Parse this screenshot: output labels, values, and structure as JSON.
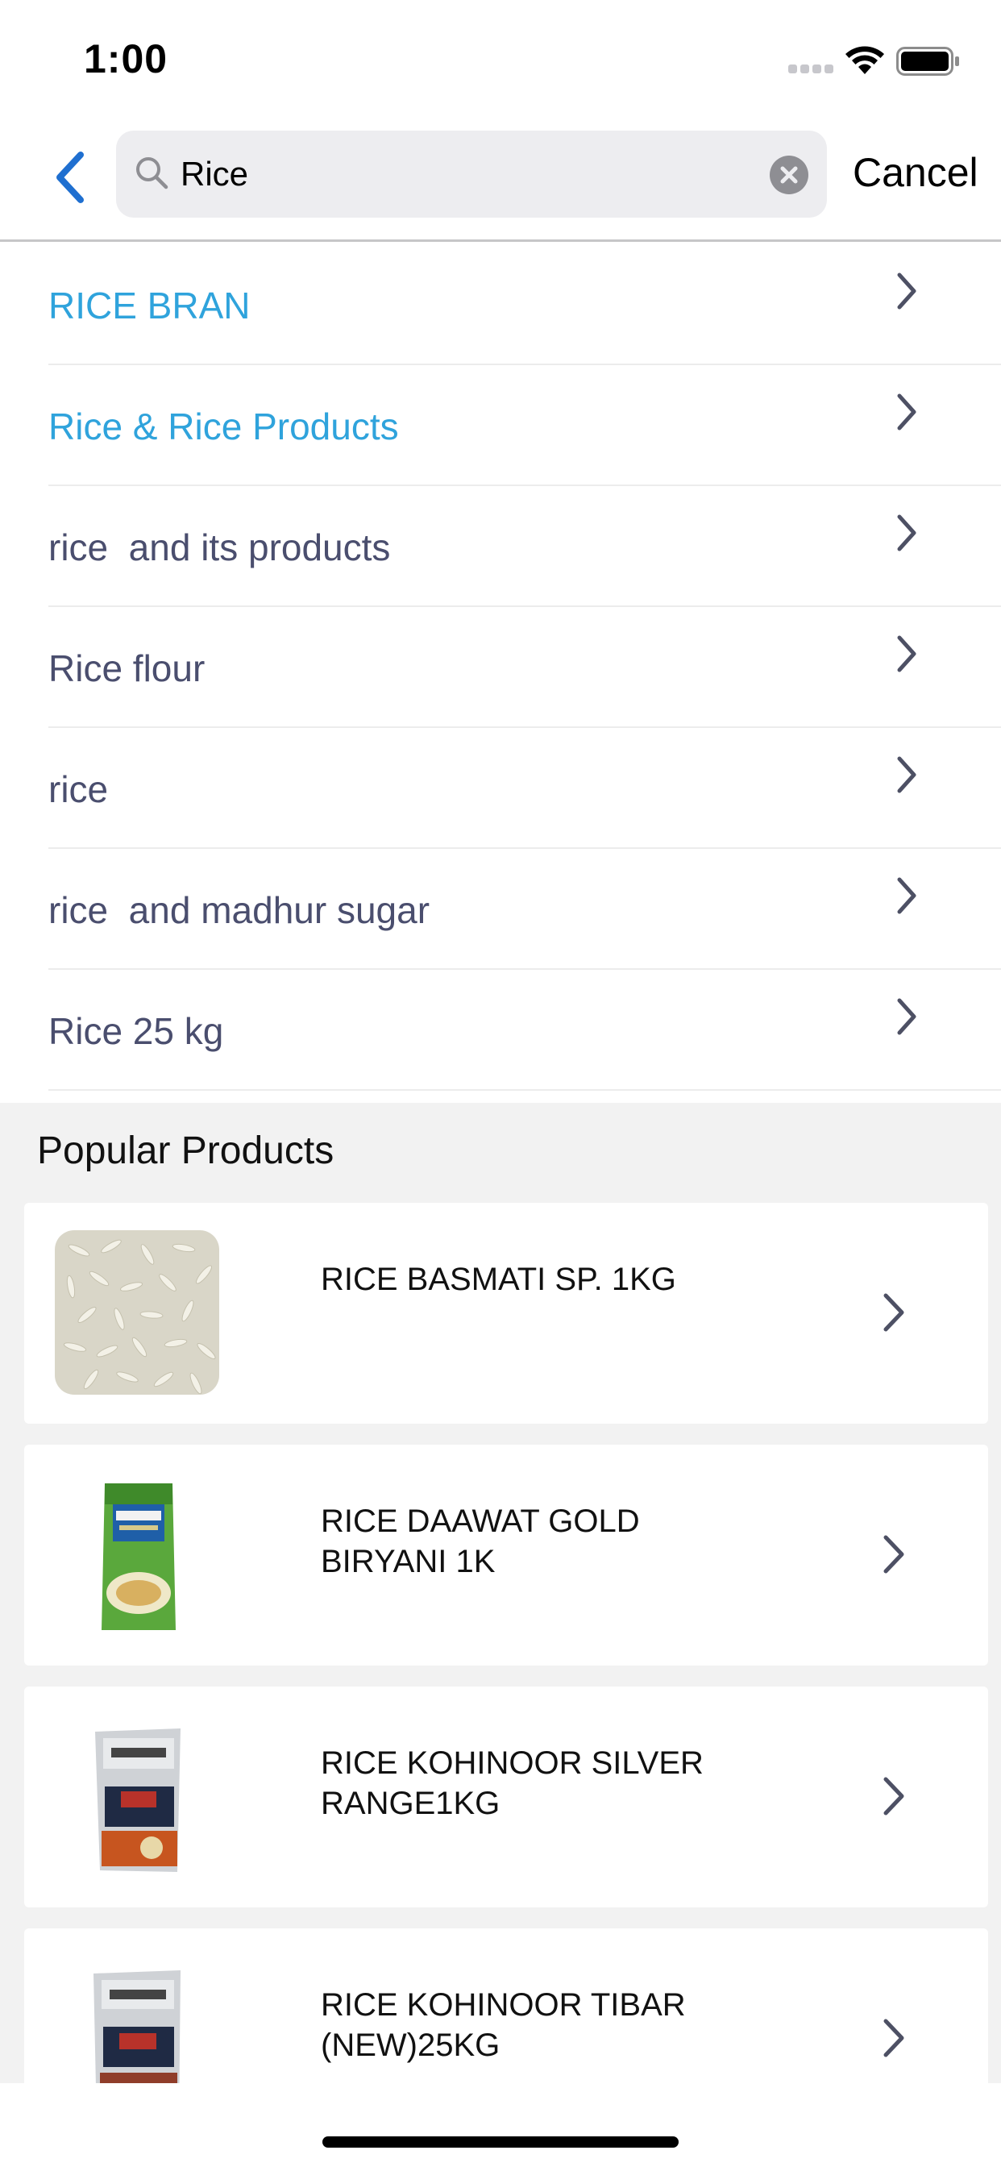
{
  "status_bar": {
    "time": "1:00"
  },
  "search": {
    "value": "Rice",
    "cancel_label": "Cancel"
  },
  "suggestions": [
    {
      "label": "RICE BRAN",
      "color": "#2fa3dc"
    },
    {
      "label": "Rice & Rice Products",
      "color": "#2fa3dc"
    },
    {
      "label": "rice  and its products",
      "color": "#4a4e6e"
    },
    {
      "label": "Rice flour",
      "color": "#4a4e6e"
    },
    {
      "label": "rice",
      "color": "#4a4e6e"
    },
    {
      "label": "rice  and madhur sugar",
      "color": "#4a4e6e"
    },
    {
      "label": "Rice 25 kg",
      "color": "#4a4e6e"
    }
  ],
  "popular": {
    "title": "Popular Products",
    "products": [
      {
        "name": "RICE BASMATI SP. 1KG",
        "image": "rice-grains-image"
      },
      {
        "name": "RICE DAAWAT GOLD BIRYANI 1K",
        "image": "daawat-biryani-pack-image"
      },
      {
        "name": "RICE KOHINOOR SILVER RANGE1KG",
        "image": "kohinoor-silver-pack-image"
      },
      {
        "name": "RICE KOHINOOR TIBAR (NEW)25KG",
        "image": "kohinoor-tibar-pack-image"
      }
    ]
  },
  "colors": {
    "accent_blue": "#1f6fd0",
    "link_blue": "#2fa3dc",
    "text_slate": "#4a4e6e",
    "arrow_gray": "#4d5064"
  }
}
